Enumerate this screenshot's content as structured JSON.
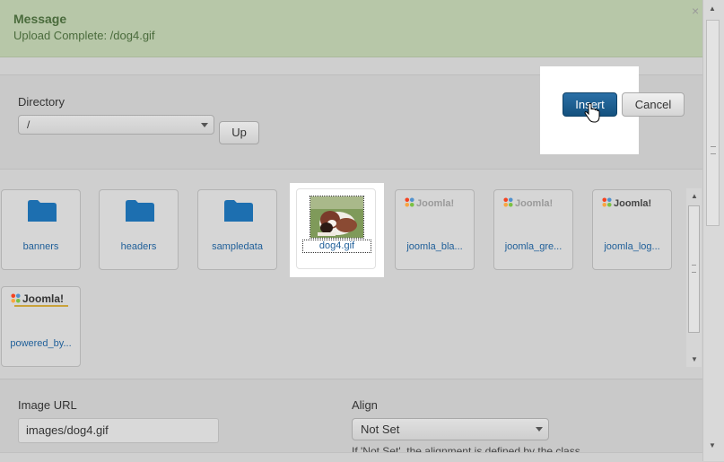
{
  "message": {
    "title": "Message",
    "text": "Upload Complete: /dog4.gif",
    "close_glyph": "×"
  },
  "directory": {
    "label": "Directory",
    "value": "/",
    "up_label": "Up"
  },
  "actions": {
    "insert_label": "Insert",
    "cancel_label": "Cancel"
  },
  "folders": [
    {
      "name": "banners"
    },
    {
      "name": "headers"
    },
    {
      "name": "sampledata"
    }
  ],
  "images": [
    {
      "name": "dog4.gif",
      "selected": true
    },
    {
      "name": "joomla_bla...",
      "logo": "Joomla!"
    },
    {
      "name": "joomla_gre...",
      "logo": "Joomla!"
    },
    {
      "name": "joomla_log...",
      "logo": "Joomla!"
    },
    {
      "name": "powered_by...",
      "logo": "Joomla!"
    }
  ],
  "image_url": {
    "label": "Image URL",
    "value": "images/dog4.gif"
  },
  "align": {
    "label": "Align",
    "value": "Not Set",
    "help": "If 'Not Set', the alignment is defined by the class"
  },
  "colors": {
    "message_bg": "#b7c7a8",
    "insert_bg": "#1a5a8c",
    "link": "#1f5f99",
    "folder": "#1d6fb0"
  },
  "icons": {
    "folder": "folder-icon",
    "joomla": "joomla-logo-icon",
    "cursor": "hand-pointer-icon"
  }
}
